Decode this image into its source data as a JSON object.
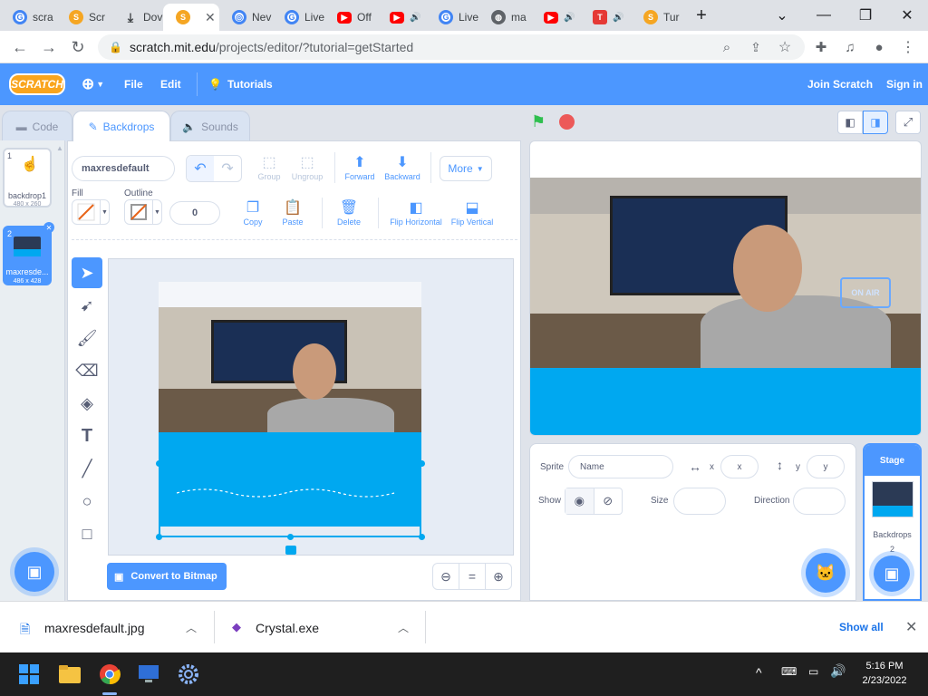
{
  "browser": {
    "tabs": [
      {
        "title": "scra",
        "icon": "google-icon"
      },
      {
        "title": "Scr",
        "icon": "scratch-icon"
      },
      {
        "title": "Dov",
        "icon": "download-icon"
      },
      {
        "title": "",
        "icon": "scratch-icon"
      },
      {
        "title": "Nev",
        "icon": "chrome-icon"
      },
      {
        "title": "Live",
        "icon": "google-icon"
      },
      {
        "title": "Off",
        "icon": "youtube-icon"
      },
      {
        "title": "",
        "icon": "youtube-icon"
      },
      {
        "title": "Live",
        "icon": "google-icon"
      },
      {
        "title": "ma",
        "icon": "globe-icon"
      },
      {
        "title": "",
        "icon": "youtube-icon"
      },
      {
        "title": "",
        "icon": "t-icon"
      },
      {
        "title": "Tur",
        "icon": "scratch-icon"
      }
    ],
    "url_host": "scratch.mit.edu",
    "url_path": "/projects/editor/?tutorial=getStarted"
  },
  "menu": {
    "logo": "SCRATCH",
    "file": "File",
    "edit": "Edit",
    "tutorials": "Tutorials",
    "join": "Join Scratch",
    "signin": "Sign in"
  },
  "editor_tabs": {
    "code": "Code",
    "backdrops": "Backdrops",
    "sounds": "Sounds"
  },
  "backdrops": [
    {
      "index": "1",
      "name": "backdrop1",
      "size": "480 x 260"
    },
    {
      "index": "2",
      "name": "maxresde...",
      "size": "486 x 428"
    }
  ],
  "paint": {
    "costume_name": "maxresdefault",
    "group": "Group",
    "ungroup": "Ungroup",
    "forward": "Forward",
    "backward": "Backward",
    "more": "More",
    "fill_label": "Fill",
    "outline_label": "Outline",
    "outline_width": "0",
    "copy": "Copy",
    "paste": "Paste",
    "delete": "Delete",
    "flip_h": "Flip Horizontal",
    "flip_v": "Flip Vertical",
    "convert": "Convert to Bitmap",
    "zoom_reset": "="
  },
  "sprite_info": {
    "sprite_label": "Sprite",
    "name_placeholder": "Name",
    "x_label": "x",
    "x_placeholder": "x",
    "y_label": "y",
    "y_placeholder": "y",
    "show_label": "Show",
    "size_label": "Size",
    "direction_label": "Direction"
  },
  "stage_panel": {
    "title": "Stage",
    "backdrops_label": "Backdrops",
    "backdrops_count": "2"
  },
  "downloads": {
    "file1": "maxresdefault.jpg",
    "file2": "Crystal.exe",
    "show_all": "Show all"
  },
  "taskbar": {
    "time": "5:16 PM",
    "date": "2/23/2022"
  },
  "colors": {
    "accent": "#4c97ff",
    "menubar": "#4c97ff",
    "fill_blue": "#00a8f0"
  }
}
